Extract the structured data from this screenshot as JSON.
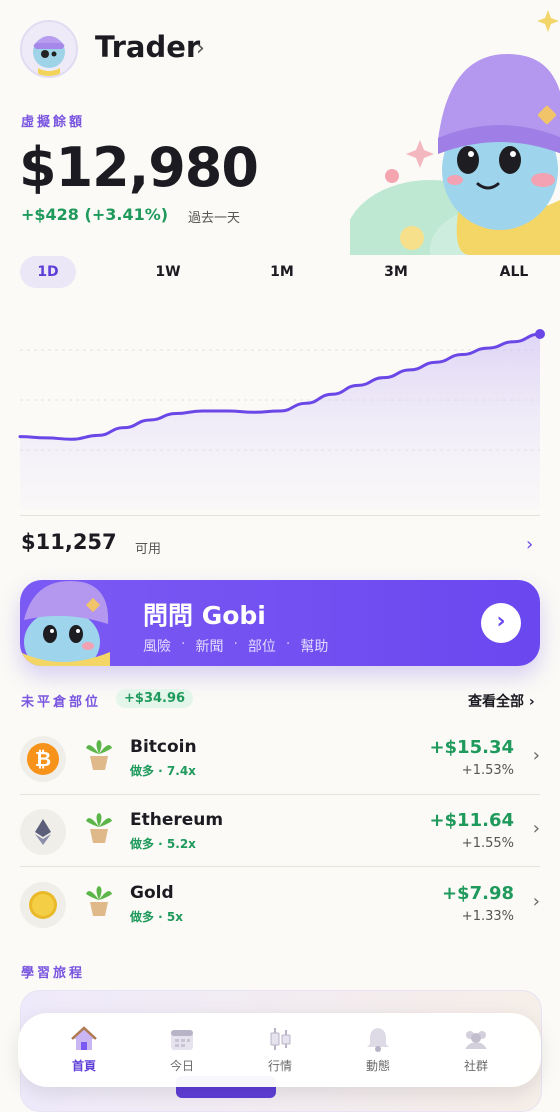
{
  "header": {
    "username": "Trader",
    "chevron": "›"
  },
  "balance": {
    "label": "虛擬餘額",
    "value": "$12,980",
    "change": "+$428 (+3.41%)",
    "period": "過去一天"
  },
  "tabs": [
    {
      "label": "1D",
      "active": true
    },
    {
      "label": "1W",
      "active": false
    },
    {
      "label": "1M",
      "active": false
    },
    {
      "label": "3M",
      "active": false
    },
    {
      "label": "ALL",
      "active": false
    }
  ],
  "chart_data": {
    "type": "area",
    "x": [
      0,
      1,
      2,
      3,
      4,
      5,
      6,
      7,
      8,
      9,
      10,
      11,
      12,
      13,
      14,
      15,
      16,
      17,
      18,
      19,
      20
    ],
    "series": [
      {
        "values": [
          0.26,
          0.25,
          0.24,
          0.27,
          0.33,
          0.39,
          0.44,
          0.46,
          0.46,
          0.45,
          0.46,
          0.52,
          0.59,
          0.66,
          0.72,
          0.78,
          0.84,
          0.9,
          0.95,
          1.0,
          1.06
        ]
      }
    ],
    "grid": true,
    "color": "#6a47e6"
  },
  "available": {
    "value": "$11,257",
    "label": "可用",
    "chevron": "›"
  },
  "ask": {
    "title": "問問 Gobi",
    "tags": [
      "風險",
      "新聞",
      "部位",
      "幫助"
    ],
    "separator": "·",
    "button": "›"
  },
  "positions": {
    "title": "未平倉部位",
    "total": "+$34.96",
    "view_all": "查看全部 ›",
    "items": [
      {
        "name": "Bitcoin",
        "sub": "做多 · 7.4x",
        "pnl": "+$15.34",
        "pct": "+1.53%",
        "icon": "bitcoin-icon"
      },
      {
        "name": "Ethereum",
        "sub": "做多 · 5.2x",
        "pnl": "+$11.64",
        "pct": "+1.55%",
        "icon": "ethereum-icon"
      },
      {
        "name": "Gold",
        "sub": "做多 · 5x",
        "pnl": "+$7.98",
        "pct": "+1.33%",
        "icon": "gold-icon"
      }
    ],
    "chevron": "›"
  },
  "journey": {
    "title": "學習旅程"
  },
  "nav": [
    {
      "label": "首頁",
      "icon": "home-icon",
      "active": true
    },
    {
      "label": "今日",
      "icon": "calendar-icon",
      "active": false
    },
    {
      "label": "行情",
      "icon": "candlestick-icon",
      "active": false
    },
    {
      "label": "動態",
      "icon": "bell-icon",
      "active": false
    },
    {
      "label": "社群",
      "icon": "community-icon",
      "active": false
    }
  ],
  "colors": {
    "accent": "#6a47ef",
    "positive": "#1f9a5c",
    "background": "#fbfaf6"
  }
}
